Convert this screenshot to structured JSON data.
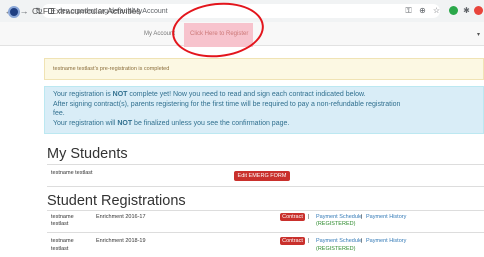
{
  "browser": {
    "url": "dev.crpadmt.org/default/MyAccount"
  },
  "navbar": {
    "brand": "CLF Extracurricular Activities",
    "my_account": "My Account",
    "how_to_register": "Click Here to Register"
  },
  "alerts": {
    "warning": "testname testlast's pre-registration is completed",
    "info": {
      "line1_pre": "Your registration is ",
      "line1_not": "NOT",
      "line1_post": " complete yet! Now you need to read and sign each contract indicated below.",
      "line2": "After signing contract(s), parents registering for the first time will be required to pay a non-refundable registration",
      "line3": "fee.",
      "line4_pre": "Your registration will ",
      "line4_not": "NOT",
      "line4_post": " be finalized unless you see the confirmation page."
    }
  },
  "students": {
    "heading": "My Students",
    "rows": [
      {
        "name": "testname testlast",
        "button": "Edit EMERG FORM"
      }
    ]
  },
  "registrations": {
    "heading": "Student Registrations",
    "rows": [
      {
        "name_first": "testname",
        "name_last": "testlast",
        "program": "Enrichment 2016-17",
        "contract": "Contract",
        "payment_schedule": "Payment Schedule",
        "payment_history": "Payment History",
        "status": "(REGISTERED)"
      },
      {
        "name_first": "testname",
        "name_last": "testlast",
        "program": "Enrichment 2018-19",
        "contract": "Contract",
        "payment_schedule": "Payment Schedule",
        "payment_history": "Payment History",
        "status": "(REGISTERED)"
      }
    ]
  },
  "colors": {
    "danger": "#c9302c",
    "info_bg": "#d9edf7",
    "warning_bg": "#fcf8e3",
    "link": "#337ab7",
    "annotation_circle": "#e3151c"
  }
}
